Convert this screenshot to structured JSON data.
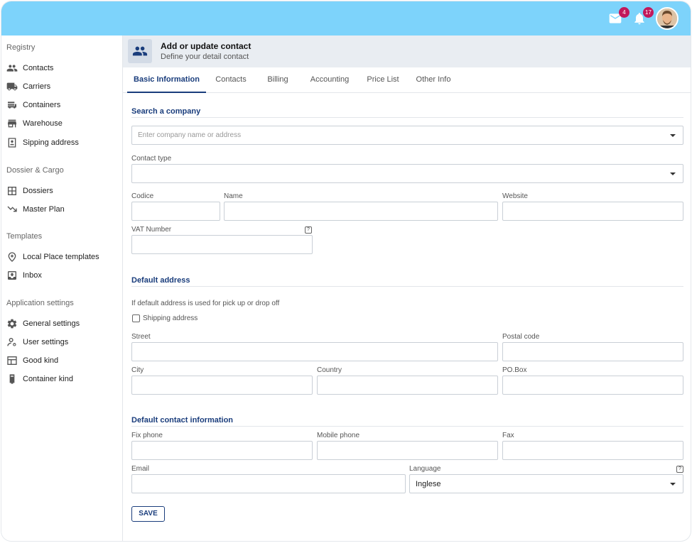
{
  "header": {
    "mail_count": "4",
    "notif_count": "17"
  },
  "sidebar": {
    "sections": [
      {
        "title": "Registry",
        "items": [
          {
            "label": "Contacts",
            "icon": "contacts-icon"
          },
          {
            "label": "Carriers",
            "icon": "truck-icon"
          },
          {
            "label": "Containers",
            "icon": "container-icon"
          },
          {
            "label": "Warehouse",
            "icon": "warehouse-icon"
          },
          {
            "label": "Sipping address",
            "icon": "address-icon"
          }
        ]
      },
      {
        "title": "Dossier & Cargo",
        "items": [
          {
            "label": "Dossiers",
            "icon": "dossier-icon"
          },
          {
            "label": "Master Plan",
            "icon": "route-icon"
          }
        ]
      },
      {
        "title": "Templates",
        "items": [
          {
            "label": "Local Place templates",
            "icon": "place-icon"
          },
          {
            "label": "Inbox",
            "icon": "inbox-icon"
          }
        ]
      },
      {
        "title": "Application settings",
        "items": [
          {
            "label": "General settings",
            "icon": "gear-icon"
          },
          {
            "label": "User settings",
            "icon": "user-settings-icon"
          },
          {
            "label": "Good kind",
            "icon": "good-kind-icon"
          },
          {
            "label": "Container kind",
            "icon": "container-kind-icon"
          }
        ]
      }
    ]
  },
  "page": {
    "title": "Add or update contact",
    "subtitle": "Define your detail contact"
  },
  "tabs": [
    "Basic Information",
    "Contacts",
    "Billing",
    "Accounting",
    "Price List",
    "Other Info"
  ],
  "form": {
    "search_title": "Search a company",
    "search_placeholder": "Enter company name or address",
    "contact_type_label": "Contact type",
    "codice_label": "Codice",
    "name_label": "Name",
    "website_label": "Website",
    "vat_label": "VAT Number",
    "default_address_title": "Default address",
    "default_address_note": "If default address is used for pick up or drop off",
    "shipping_address_label": "Shipping address",
    "street_label": "Street",
    "postal_code_label": "Postal code",
    "city_label": "City",
    "country_label": "Country",
    "pobox_label": "PO.Box",
    "contact_info_title": "Default contact information",
    "fix_phone_label": "Fix phone",
    "mobile_phone_label": "Mobile phone",
    "fax_label": "Fax",
    "email_label": "Email",
    "language_label": "Language",
    "language_value": "Inglese",
    "save_label": "SAVE"
  }
}
